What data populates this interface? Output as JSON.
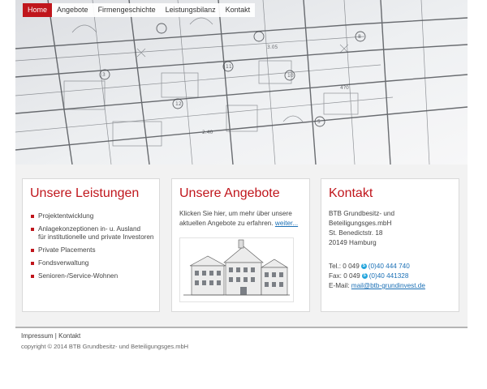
{
  "nav": {
    "items": [
      "Home",
      "Angebote",
      "Firmengeschichte",
      "Leistungsbilanz",
      "Kontakt"
    ],
    "active_index": 0
  },
  "leistungen": {
    "title": "Unsere Leistungen",
    "items": [
      "Projektentwicklung",
      "Anlagekonzeptionen in- u. Ausland",
      "für institutionelle und private Investoren",
      "Private Placements",
      "Fondsverwaltung",
      "Senioren-/Service-Wohnen"
    ]
  },
  "angebote": {
    "title": "Unsere Angebote",
    "text_line1": "Klicken Sie hier, um mehr über unsere",
    "text_line2": "aktuellen Angebote zu erfahren.",
    "more_link": "weiter..."
  },
  "kontakt": {
    "title": "Kontakt",
    "company_line1": "BTB Grundbesitz- und",
    "company_line2": "Beteiligungsges.mbH",
    "street": "St. Benedictstr. 18",
    "city": "20149 Hamburg",
    "tel_label": "Tel.: 0 049",
    "tel_number": "(0)40 444 740",
    "fax_label": "Fax: 0 049",
    "fax_number": "(0)40 441328",
    "email_label": "E-Mail:",
    "email": "mail@btb-grundinvest.de"
  },
  "footer": {
    "impressum": "Impressum",
    "separator": "|",
    "kontakt": "Kontakt",
    "copyright": "copyright © 2014 BTB Grundbesitz- und Beteiligungsges.mbH"
  },
  "colors": {
    "accent": "#c0161c",
    "link": "#1a6fb5",
    "skype": "#23a5dd"
  },
  "icons": [
    "skype-icon"
  ]
}
